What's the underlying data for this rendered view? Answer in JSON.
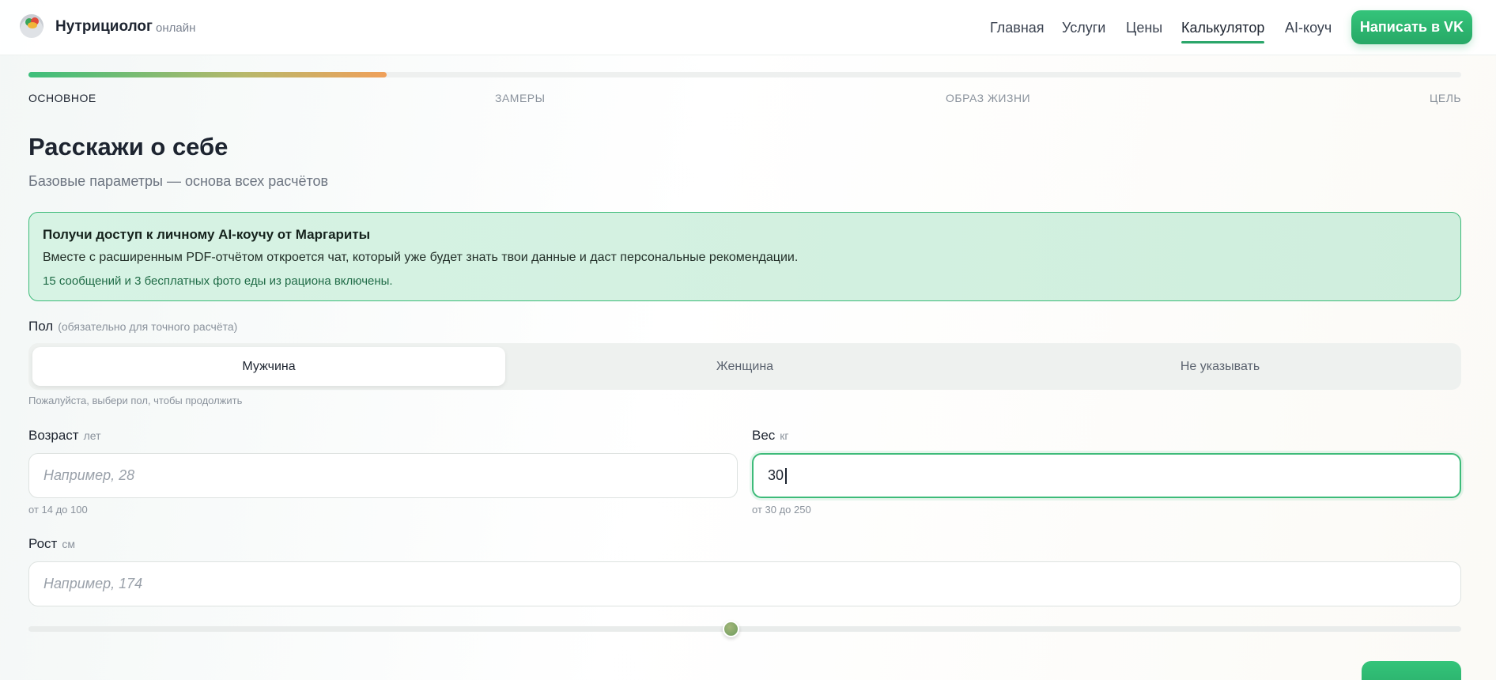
{
  "header": {
    "brand": "Нутрициолог",
    "brand_sub": "онлайн",
    "nav": [
      "Главная",
      "Услуги",
      "Цены",
      "Калькулятор",
      "AI-коуч"
    ],
    "active_nav": "Калькулятор",
    "cta": "Написать в VK"
  },
  "progress": {
    "value_percent": 25,
    "steps": [
      "ОСНОВНОЕ",
      "ЗАМЕРЫ",
      "ОБРАЗ ЖИЗНИ",
      "ЦЕЛЬ"
    ],
    "active_step": "ОСНОВНОЕ"
  },
  "form": {
    "title": "Расскажи о себе",
    "subtitle": "Базовые параметры — основа всех расчётов",
    "promo": {
      "title": "Получи доступ к личному AI-коучу от Маргариты",
      "text": "Вместе с расширенным PDF-отчётом откроется чат, который уже будет знать твои данные и даст персональные рекомендации.",
      "note": "15 сообщений и 3 бесплатных фото еды из рациона включены."
    },
    "gender": {
      "label": "Пол",
      "hint": "(обязательно для точного расчёта)",
      "options": [
        "Мужчина",
        "Женщина",
        "Не указывать"
      ],
      "selected": "Мужчина",
      "helper": "Пожалуйста, выбери пол, чтобы продолжить"
    },
    "age": {
      "label": "Возраст",
      "unit": "лет",
      "placeholder": "Например, 28",
      "value": "",
      "helper": "от 14 до 100"
    },
    "weight": {
      "label": "Вес",
      "unit": "кг",
      "value": "30",
      "helper": "от 30 до 250"
    },
    "height": {
      "label": "Рост",
      "unit": "см",
      "placeholder": "Например, 174",
      "value": "",
      "slider_percent": 49
    },
    "next_button": ""
  },
  "colors": {
    "accent": "#2ba66a",
    "promo_bg": "#d7f3e4"
  }
}
